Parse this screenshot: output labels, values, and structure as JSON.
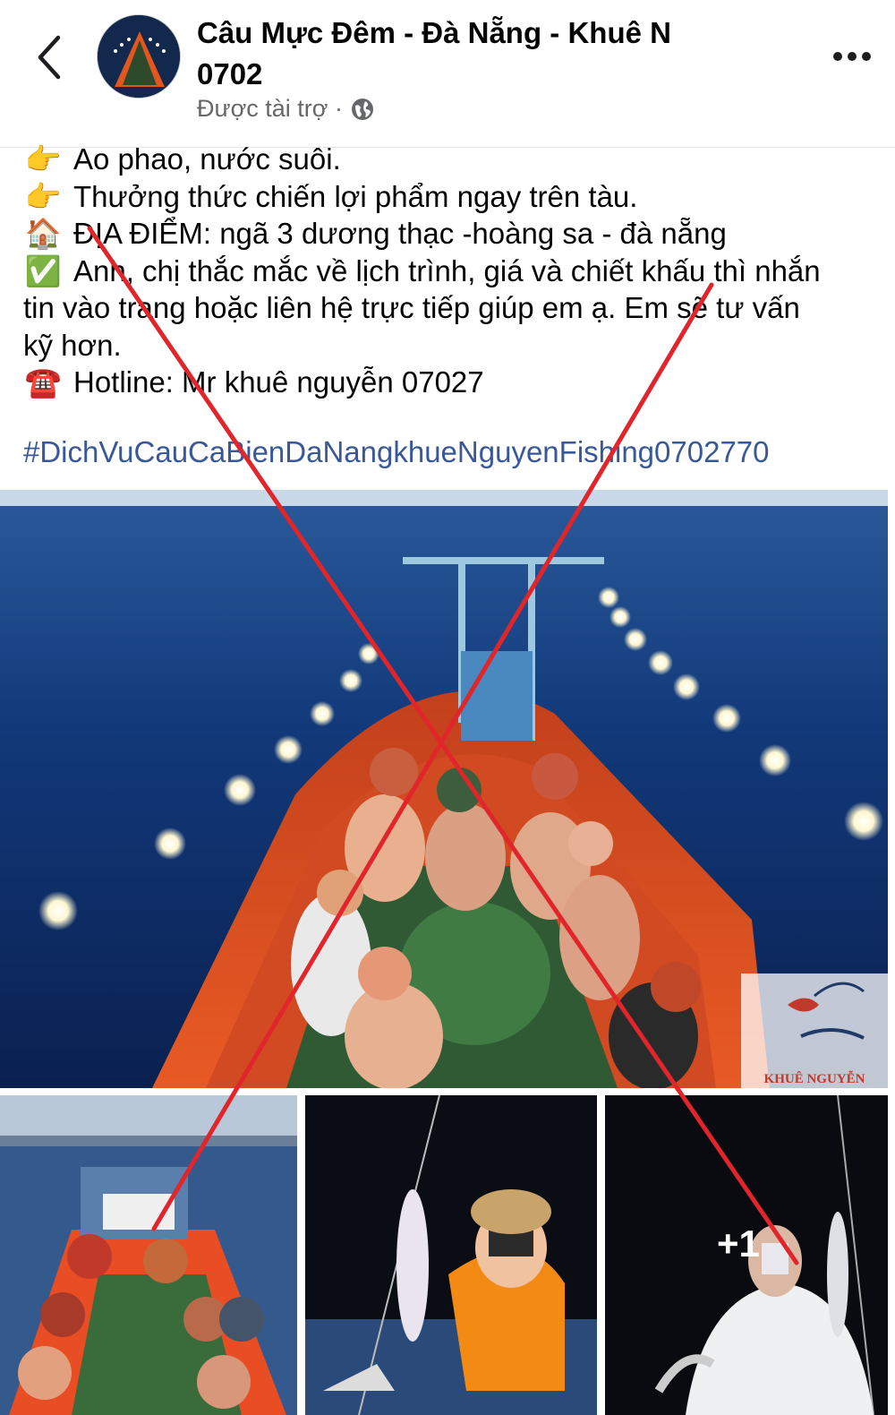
{
  "header": {
    "page_name_line1": "Câu Mực Đêm - Đà Nẵng - Khuê N",
    "page_name_line2": "0702",
    "sponsored": "Được tài trợ ·",
    "back_icon": "chevron-left-icon",
    "more_icon": "more-dots-icon",
    "globe_icon": "globe-icon"
  },
  "post": {
    "lines": [
      {
        "emoji": "👉",
        "text": "Ao phao, nước suôi."
      },
      {
        "emoji": "👉",
        "text": "Thưởng thức chiến lợi phẩm ngay trên tàu."
      },
      {
        "emoji": "🏠",
        "text": "ĐỊA ĐIỂM: ngã 3 dương thạc -hoàng sa - đà nẵng"
      },
      {
        "emoji": "✅",
        "text": "Anh, chị thắc mắc về lịch trình, giá và chiết khấu thì nhắn"
      },
      {
        "emoji": "",
        "text": "tin vào trang hoặc liên hệ trực tiếp giúp em ạ. Em sẽ tư vấn"
      },
      {
        "emoji": "",
        "text": "kỹ hơn."
      },
      {
        "emoji": "☎️",
        "text": "Hotline: Mr khuê nguyễn 07027"
      }
    ],
    "hashtag": "#DichVuCauCaBienDaNangkhueNguyenFishing0702770"
  },
  "photos": {
    "watermark": "KHUÊ NGUYỄN",
    "more_label": "+1"
  },
  "colors": {
    "red_cross": "#e0252b",
    "hashtag": "#385898",
    "sea": "#0f3a7a",
    "boat": "#e8431d"
  }
}
